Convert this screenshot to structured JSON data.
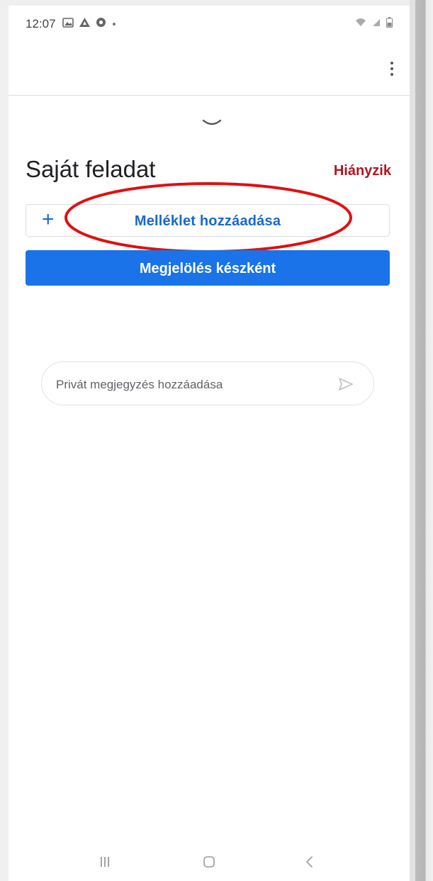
{
  "status_bar": {
    "time": "12:07",
    "left_icons": [
      "gallery-icon",
      "drive-icon",
      "chrome-icon",
      "notification-dot-icon"
    ],
    "right_icons": [
      "wifi-icon",
      "signal-icon",
      "battery-icon"
    ]
  },
  "toolbar": {
    "more_icon": "more-vert-icon"
  },
  "task": {
    "title": "Saját feladat",
    "status": "Hiányzik",
    "add_attachment_label": "Melléklet hozzáadása",
    "mark_done_label": "Megjelölés készként"
  },
  "private_note": {
    "placeholder": "Privát megjegyzés hozzáadása"
  },
  "nav_bar": {
    "icons": [
      "recent-apps-icon",
      "home-icon",
      "back-icon"
    ]
  },
  "colors": {
    "accent": "#1a73e8",
    "accent_text": "#1967d2",
    "missing_red": "#b3141f",
    "annotation_red": "#e01010"
  }
}
